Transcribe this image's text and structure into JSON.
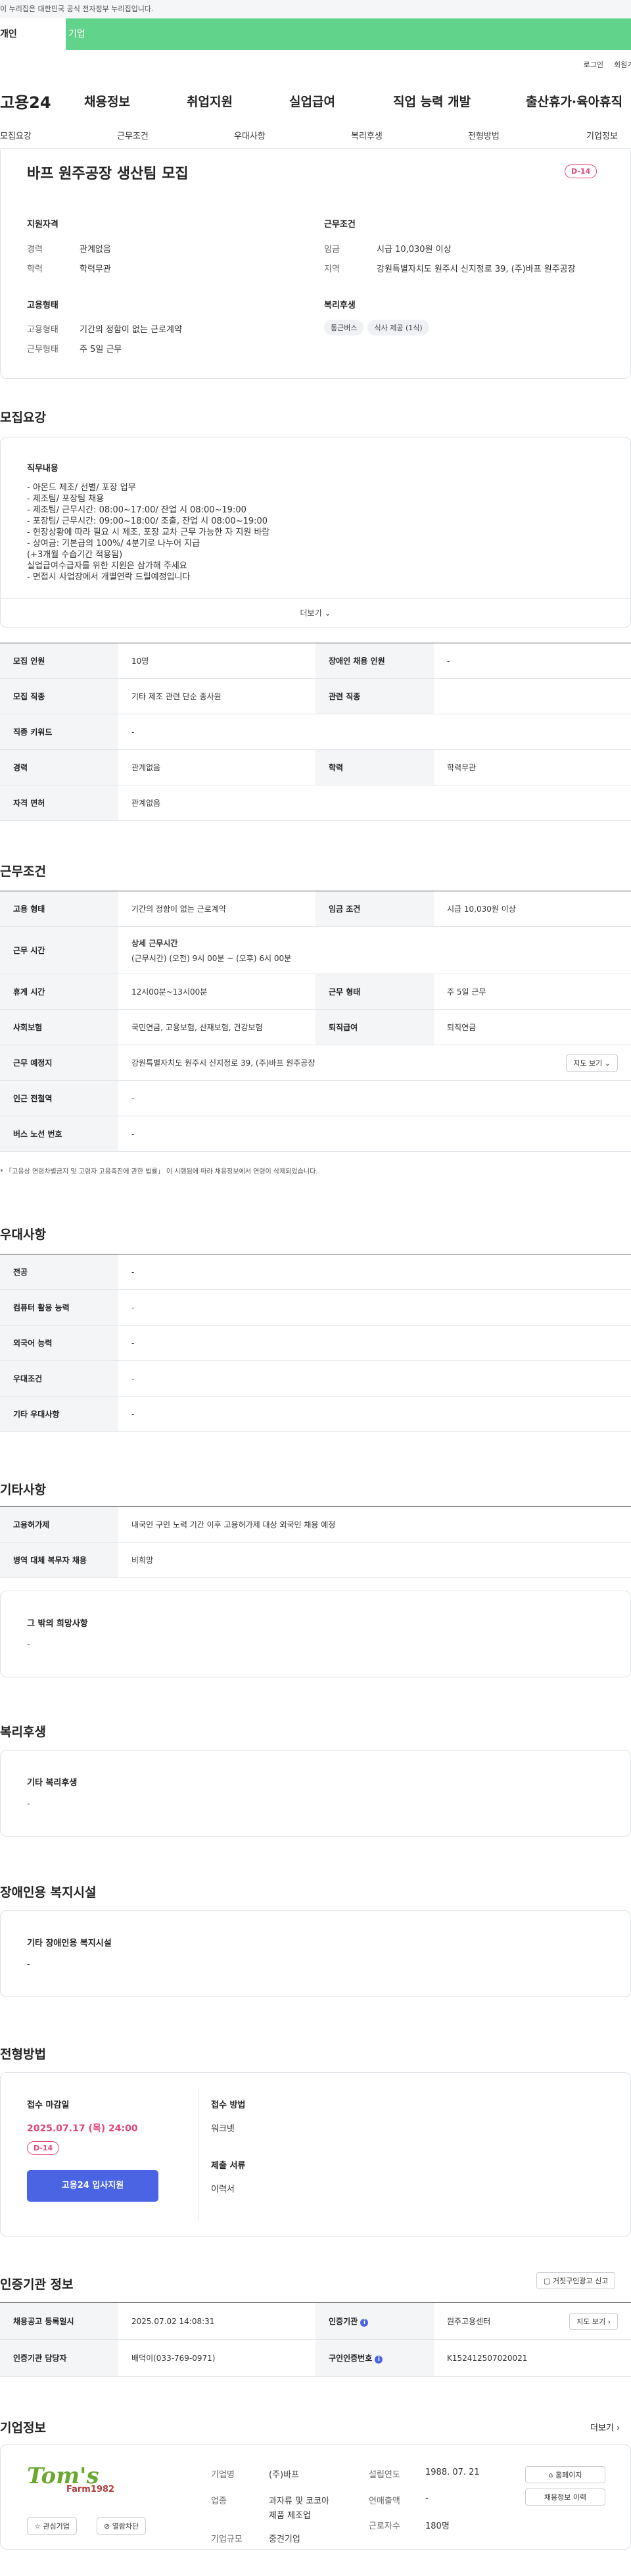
{
  "topbar": {
    "notice": "이 누리집은 대한민국 공식 전자정부 누리집입니다."
  },
  "portal_tabs": {
    "personal": "개인",
    "business": "기업"
  },
  "util": {
    "login": "로그인",
    "join": "회원가입"
  },
  "gnb": {
    "logo": "고용24",
    "m1": "채용정보",
    "m2": "취업지원",
    "m3": "실업급여",
    "m4": "직업 능력 개발",
    "m5": "출산휴가·육아휴직"
  },
  "snb": [
    "모집요강",
    "근무조건",
    "우대사항",
    "복리후생",
    "전형방법",
    "기업정보"
  ],
  "summary": {
    "title": "바프 원주공장 생산팀 모집",
    "dday": "D-14",
    "qual_title": "지원자격",
    "career_k": "경력",
    "career_v": "관계없음",
    "edu_k": "학력",
    "edu_v": "학력무관",
    "cond_title": "근무조건",
    "wage_k": "임금",
    "wage_v": "시급 10,030원 이상",
    "loc_k": "지역",
    "loc_v": "강원특별자치도 원주시 신지정로 39, (주)바프 원주공장",
    "emp_title": "고용형태",
    "emptype_k": "고용형태",
    "emptype_v": "기간의 정함이 없는 근로계약",
    "workform_k": "근무형태",
    "workform_v": "주 5일 근무",
    "welfare_title": "복리후생",
    "chip1": "통근버스",
    "chip2": "식사 제공 (1식)"
  },
  "recruit": {
    "heading": "모집요강",
    "job_title": "직무내용",
    "lines": [
      "- 아몬드 제조/ 선별/ 포장 업무",
      "- 제조팀/ 포장팀 채용",
      "- 제조팀/ 근무시간: 08:00~17:00/ 잔업 시 08:00~19:00",
      "- 포장팀/ 근무시간: 09:00~18:00/ 조출, 잔업 시 08:00~19:00",
      "- 현장상황에 따라 필요 시 제조, 포장 교차 근무 가능한 자 지원 바람",
      "- 상여금: 기본급의 100%/ 4분기로 나누어 지급",
      "(+3개월 수습기간 적용됨)",
      "실업급여수급자를 위한 지원은 삼가해 주세요",
      "- 면접시 사업장에서 개별연락 드릴예정입니다"
    ],
    "more": "더보기",
    "t": {
      "count_k": "모집 인원",
      "count_v": "10명",
      "disabled_k": "장애인 채용 인원",
      "disabled_v": "-",
      "job_k": "모집 직종",
      "job_v": "기타 제조 관련 단순 종사원",
      "rel_k": "관련 직종",
      "rel_v": "",
      "kw_k": "직종 키워드",
      "kw_v": "-",
      "career_k": "경력",
      "career_v": "관계없음",
      "edu_k": "학력",
      "edu_v": "학력무관",
      "lic_k": "자격 면허",
      "lic_v": "관계없음"
    }
  },
  "cond": {
    "heading": "근무조건",
    "emp_k": "고용 형태",
    "emp_v": "기간의 정함이 없는 근로계약",
    "wage_k": "임금 조건",
    "wage_v": "시급 10,030원 이상",
    "hours_k": "근무 시간",
    "hours_t": "상세 근무시간",
    "hours_v": "(근무시간) (오전) 9시 00분 ~ (오후) 6시 00분",
    "rest_k": "휴게 시간",
    "rest_v": "12시00분~13시00분",
    "form_k": "근무 형태",
    "form_v": "주 5일 근무",
    "ins_k": "사회보험",
    "ins_v": "국민연금, 고용보험, 산재보험, 건강보험",
    "ret_k": "퇴직급여",
    "ret_v": "퇴직연금",
    "addr_k": "근무 예정지",
    "addr_v": "강원특별자치도 원주시 신지정로 39, (주)바프 원주공장",
    "map": "지도 보기",
    "sub_k": "인근 전철역",
    "sub_v": "-",
    "bus_k": "버스 노선 번호",
    "bus_v": "-",
    "note": "* 「고용상 연령차별금지 및 고령자 고용촉진에 관한 법률」 이 시행됨에 따라 채용정보에서 연령이 삭제되었습니다."
  },
  "pref": {
    "heading": "우대사항",
    "r1k": "전공",
    "r1v": "-",
    "r2k": "컴퓨터 활용 능력",
    "r2v": "-",
    "r3k": "외국어 능력",
    "r3v": "-",
    "r4k": "우대조건",
    "r4v": "-",
    "r5k": "기타 우대사항",
    "r5v": "-"
  },
  "etc": {
    "heading": "기타사항",
    "r1k": "고용허가제",
    "r1v": "내국인 구인 노력 기간 이후 고용허가제 대상 외국인 채용 예정",
    "r2k": "병역 대체 복무자 채용",
    "r2v": "비희망",
    "other_title": "그 밖의 희망사항",
    "other_v": "-"
  },
  "welfare": {
    "heading": "복리후생",
    "title": "기타 복리후생",
    "v": "-"
  },
  "dis": {
    "heading": "장애인용 복지시설",
    "title": "기타 장애인용 복지시설",
    "v": "-"
  },
  "proc": {
    "heading": "전형방법",
    "deadline_k": "접수 마감일",
    "deadline_v": "2025.07.17 (목) 24:00",
    "dday": "D-14",
    "apply": "고용24 입사지원",
    "method_k": "접수 방법",
    "method_v": "워크넷",
    "docs_k": "제출 서류",
    "docs_v": "이력서"
  },
  "agency": {
    "heading": "인증기관 정보",
    "report": "거짓구인광고 신고",
    "reg_k": "채용공고 등록일시",
    "reg_v": "2025.07.02 14:08:31",
    "org_k": "인증기관",
    "org_v": "원주고용센터",
    "map": "지도 보기",
    "mgr_k": "인증기관 담당자",
    "mgr_v": "배덕이(033-769-0971)",
    "num_k": "구인인증번호",
    "num_v": "K152412507020021"
  },
  "company": {
    "heading": "기업정보",
    "more": "더보기",
    "logo1": "Tom's",
    "logo2": "Farm1982",
    "fav": "관심기업",
    "block": "열람차단",
    "name_k": "기업명",
    "name_v": "(주)바프",
    "ind_k": "업종",
    "ind_v1": "과자류 및 코코아",
    "ind_v2": "제품 제조업",
    "size_k": "기업규모",
    "size_v": "중견기업",
    "est_k": "설립연도",
    "est_v": "1988. 07. 21",
    "sales_k": "연매출액",
    "sales_v": "-",
    "emp_k": "근로자수",
    "emp_v": "180명",
    "home": "홈페이지",
    "history": "채용정보 이력"
  }
}
